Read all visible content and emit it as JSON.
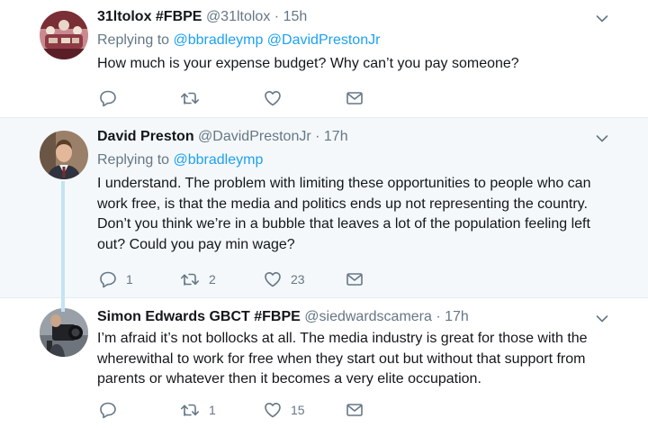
{
  "tweets": [
    {
      "name": "31ltolox #FBPE",
      "handle": "@31ltolox",
      "separator": "·",
      "time": "15h",
      "replying_prefix": "Replying to",
      "replying_to": [
        "@bbradleymp",
        "@DavidPrestonJr"
      ],
      "text": "How much is your expense budget? Why can’t you pay someone?",
      "replies": "",
      "retweets": "",
      "likes": ""
    },
    {
      "name": "David Preston",
      "handle": "@DavidPrestonJr",
      "separator": "·",
      "time": "17h",
      "replying_prefix": "Replying to",
      "replying_to": [
        "@bbradleymp"
      ],
      "text": "I understand. The problem with limiting these opportunities to people who can work free, is that the media and politics ends up not representing the country. Don’t you think we’re in a bubble that leaves a lot of the population feeling left out? Could you pay min wage?",
      "replies": "1",
      "retweets": "2",
      "likes": "23"
    },
    {
      "name": "Simon Edwards GBCT #FBPE",
      "handle": "@siedwardscamera",
      "separator": "·",
      "time": "17h",
      "text": "I’m afraid it’s not bollocks at all. The media industry is great for those with the wherewithal to work for free when they start out but without that support from parents or whatever then it becomes a very elite occupation.",
      "replies": "",
      "retweets": "1",
      "likes": "15"
    }
  ],
  "icons": {
    "reply": "reply-icon",
    "retweet": "retweet-icon",
    "like": "heart-icon",
    "dm": "envelope-icon",
    "more": "chevron-down-icon"
  },
  "colors": {
    "link": "#1da1f2",
    "muted": "#657786",
    "text": "#14171a",
    "highlight_bg": "#f5f8fa",
    "thread_line": "#c4e3f3"
  }
}
